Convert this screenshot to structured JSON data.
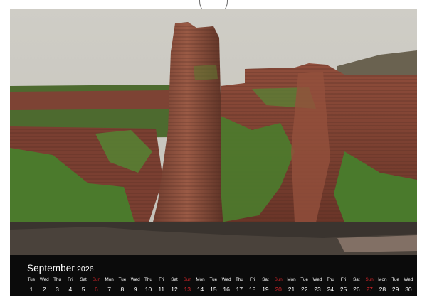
{
  "calendar": {
    "month": "September",
    "year": "2026",
    "days": [
      {
        "wd": "Tue",
        "d": "1"
      },
      {
        "wd": "Wed",
        "d": "2"
      },
      {
        "wd": "Thu",
        "d": "3"
      },
      {
        "wd": "Fri",
        "d": "4"
      },
      {
        "wd": "Sat",
        "d": "5"
      },
      {
        "wd": "Sun",
        "d": "6"
      },
      {
        "wd": "Mon",
        "d": "7"
      },
      {
        "wd": "Tue",
        "d": "8"
      },
      {
        "wd": "Wed",
        "d": "9"
      },
      {
        "wd": "Thu",
        "d": "10"
      },
      {
        "wd": "Fri",
        "d": "11"
      },
      {
        "wd": "Sat",
        "d": "12"
      },
      {
        "wd": "Sun",
        "d": "13"
      },
      {
        "wd": "Mon",
        "d": "14"
      },
      {
        "wd": "Tue",
        "d": "15"
      },
      {
        "wd": "Wed",
        "d": "16"
      },
      {
        "wd": "Thu",
        "d": "17"
      },
      {
        "wd": "Fri",
        "d": "18"
      },
      {
        "wd": "Sat",
        "d": "19"
      },
      {
        "wd": "Sun",
        "d": "20"
      },
      {
        "wd": "Mon",
        "d": "21"
      },
      {
        "wd": "Tue",
        "d": "22"
      },
      {
        "wd": "Wed",
        "d": "23"
      },
      {
        "wd": "Thu",
        "d": "24"
      },
      {
        "wd": "Fri",
        "d": "25"
      },
      {
        "wd": "Sat",
        "d": "26"
      },
      {
        "wd": "Sun",
        "d": "27"
      },
      {
        "wd": "Mon",
        "d": "28"
      },
      {
        "wd": "Tue",
        "d": "29"
      },
      {
        "wd": "Wed",
        "d": "30"
      }
    ],
    "sunday_color": "#d9252a",
    "text_color": "#ffffff",
    "background": "#0b0b0b"
  },
  "photo": {
    "sky_color": "#c9c7c0",
    "cliff_color": "#8a4a3a",
    "grass_color": "#4f7a2e"
  }
}
